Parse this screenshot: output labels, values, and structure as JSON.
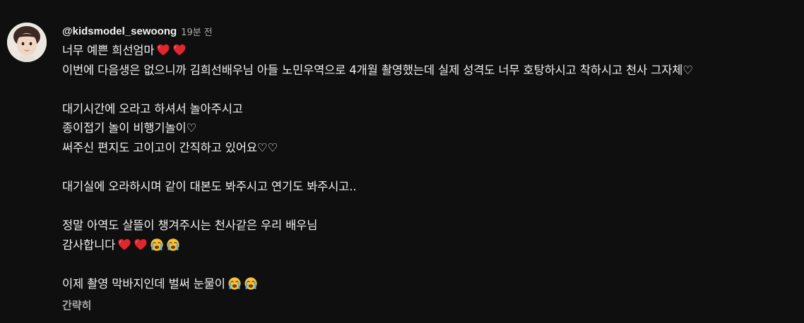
{
  "comment": {
    "author": "@kidsmodel_sewoong",
    "timestamp": "19분 전",
    "avatar_icon": "child-profile-photo",
    "lines": {
      "l1": "너무 예쁜 희선엄마",
      "l2": "이번에 다음생은 없으니까 김희선배우님 아들 노민우역으로 4개월 촬영했는데 실제 성격도 너무 호탕하시고 착하시고 천사 그자체♡",
      "l3": "대기시간에 오라고 하셔서 놀아주시고",
      "l4": "종이접기 놀이 비행기놀이♡",
      "l5": "써주신 편지도 고이고이 간직하고 있어요♡♡",
      "l6": "대기실에 오라하시며 같이 대본도 봐주시고 연기도 봐주시고..",
      "l7": "정말 아역도 살뜰이 챙겨주시는 천사같은 우리 배우님",
      "l8": "감사합니다",
      "l9": "이제 촬영 막바지인데 벌써 눈물이"
    },
    "emojis": {
      "l1": [
        "red-heart-icon",
        "red-heart-icon"
      ],
      "l8": [
        "red-heart-icon",
        "red-heart-icon",
        "crying-face-icon",
        "crying-face-icon"
      ],
      "l9": [
        "crying-face-icon",
        "crying-face-icon"
      ]
    },
    "collapse_label": "간략히"
  },
  "colors": {
    "background": "#0f0f0f",
    "text_primary": "#f1f1f1",
    "text_secondary": "#aaaaaa",
    "heart": "#e0262f",
    "crying_face": "#f7c135",
    "tears": "#5aa9e6"
  }
}
